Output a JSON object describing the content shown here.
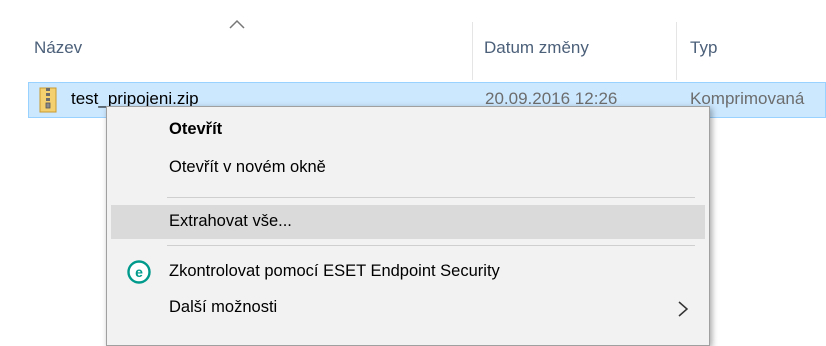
{
  "columns": {
    "name": "Název",
    "date": "Datum změny",
    "type": "Typ",
    "sort": "ascending"
  },
  "file": {
    "name": "test_pripojeni.zip",
    "date": "20.09.2016 12:26",
    "type": "Komprimovaná",
    "icon": "zip-folder-icon"
  },
  "context_menu": {
    "items": [
      {
        "label": "Otevřít",
        "bold": true
      },
      {
        "label": "Otevřít v novém okně"
      },
      {
        "label": "Extrahovat vše..."
      },
      {
        "label": "Zkontrolovat pomocí ESET Endpoint Security",
        "icon": "eset-icon"
      },
      {
        "label": "Další možnosti",
        "submenu": true
      }
    ],
    "colors": {
      "background": "#f2f2f2",
      "hover": "#dadada",
      "eset_green": "#009a8c"
    }
  }
}
